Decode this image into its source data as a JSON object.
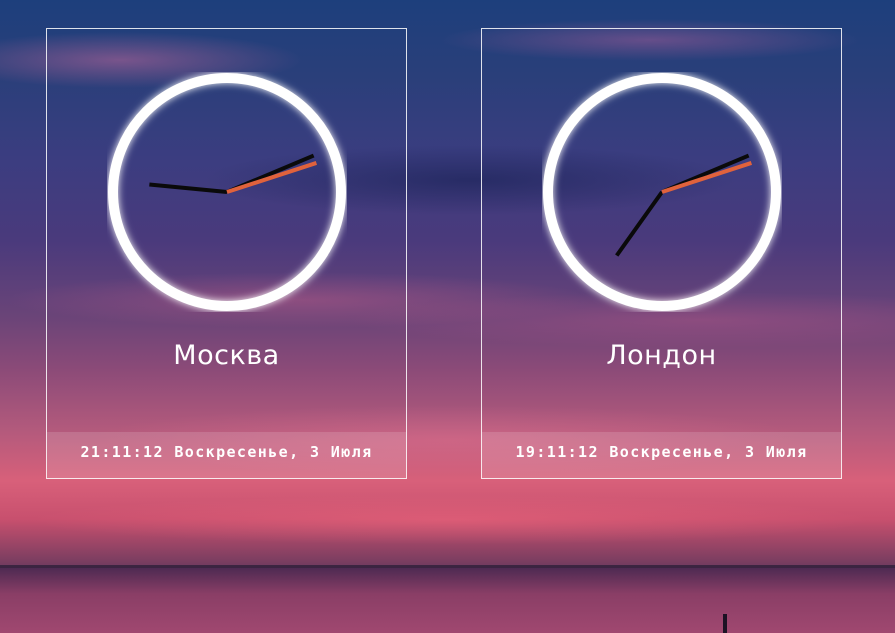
{
  "clocks": [
    {
      "city": "Москва",
      "datetime": "21:11:12 Воскресенье, 3 Июля",
      "time": {
        "hours": 21,
        "minutes": 11,
        "seconds": 12
      }
    },
    {
      "city": "Лондон",
      "datetime": "19:11:12 Воскресенье, 3 Июля",
      "time": {
        "hours": 19,
        "minutes": 11,
        "seconds": 12
      }
    }
  ],
  "colors": {
    "hand": "#0a0a0a",
    "second_hand": "#e0623c",
    "ring": "#ffffff"
  }
}
